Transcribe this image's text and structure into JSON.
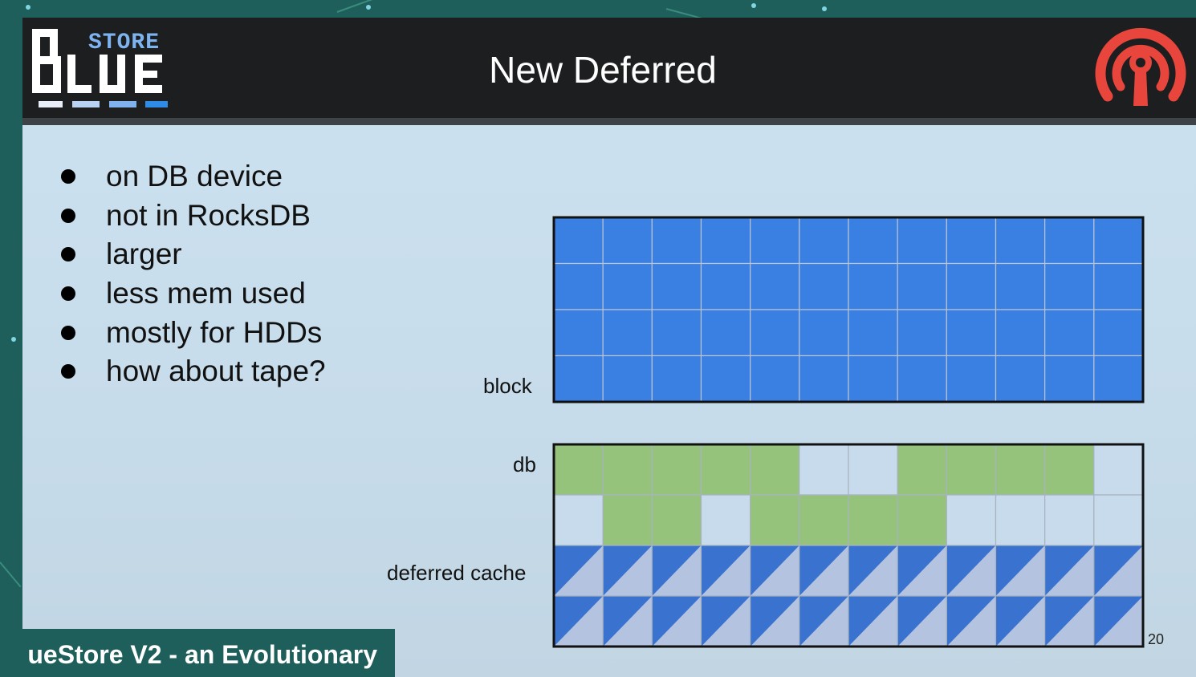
{
  "header": {
    "logo_top": "STORE",
    "logo_main": "BLUE",
    "title": "New Deferred"
  },
  "bullets": [
    "on DB device",
    "not in RocksDB",
    "larger",
    "less mem used",
    "mostly for HDDs",
    "how about tape?"
  ],
  "diagram": {
    "labels": {
      "block": "block",
      "db": "db",
      "deferred_cache": "deferred cache"
    },
    "colors": {
      "block": "#3a80e2",
      "db_used": "#95c37c",
      "empty": "#c7dbec",
      "deferred_blue": "#3a72d0",
      "deferred_light": "#b3c3e0"
    },
    "columns": 12,
    "block_rows": 4,
    "db_rows": [
      [
        1,
        1,
        1,
        1,
        1,
        0,
        0,
        1,
        1,
        1,
        1,
        0
      ],
      [
        0,
        1,
        1,
        0,
        1,
        1,
        1,
        1,
        0,
        0,
        0,
        0
      ]
    ],
    "deferred_rows": 2
  },
  "page_number": "20",
  "footer": {
    "text": "ueStore V2 - an Evolutionary"
  }
}
